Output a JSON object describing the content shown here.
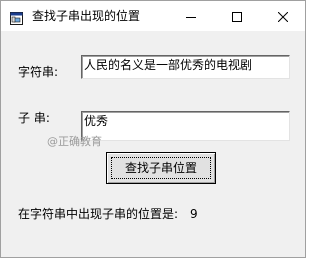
{
  "window": {
    "title": "查找子串出现的位置",
    "icon": "app-window-icon",
    "controls": [
      "minimize-icon",
      "maximize-icon",
      "close-icon"
    ]
  },
  "form": {
    "string_label": "字符串:",
    "string_value": "人民的名义是一部优秀的电视剧",
    "substring_label": "子 串:",
    "substring_value": "优秀",
    "watermark": "@正确教育",
    "find_button": "查找子串位置",
    "result_label": "在字符串中出现子串的位置是:",
    "result_value": "9"
  }
}
